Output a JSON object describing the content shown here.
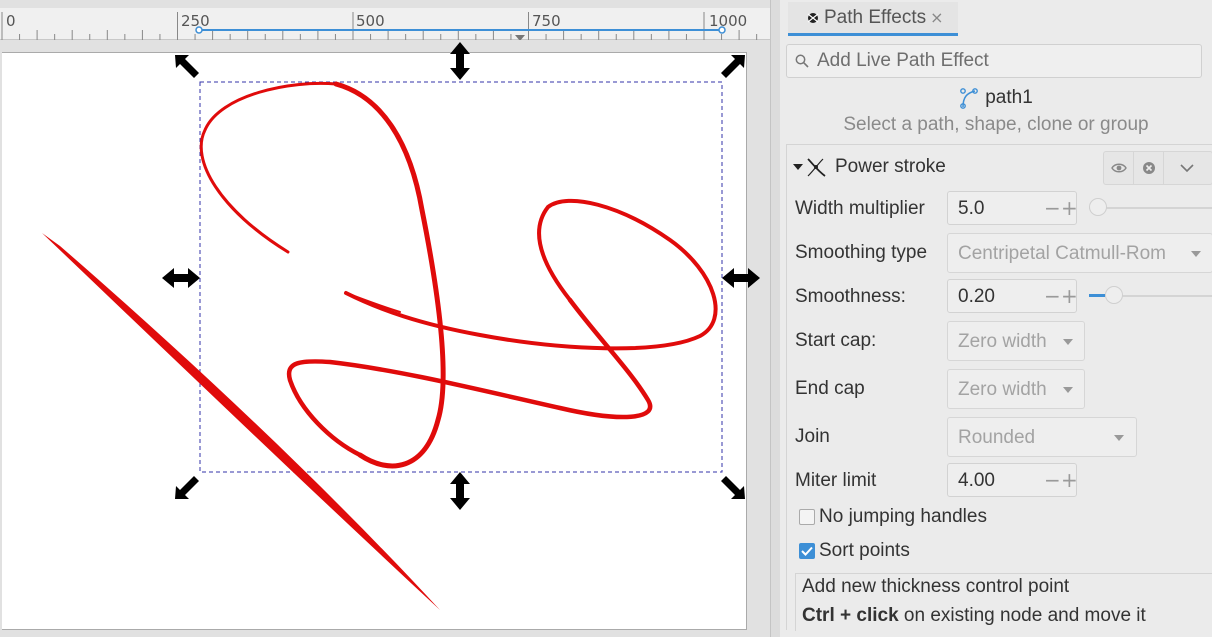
{
  "ruler": {
    "labels": [
      "0",
      "250",
      "500",
      "750",
      "1000"
    ]
  },
  "canvas": {
    "stroke_color": "#e00b0b",
    "selection_color": "#3333aa",
    "handle_color": "#000000"
  },
  "dock": {
    "tab": {
      "label": "Path Effects",
      "close_glyph": "×",
      "icon": "path-effects-icon"
    },
    "search": {
      "placeholder": "Add Live Path Effect",
      "icon": "search-icon"
    },
    "object": {
      "name": "path1",
      "icon": "path-node-icon"
    },
    "hint": "Select a path, shape, clone or group",
    "effect": {
      "title": "Power stroke",
      "icon": "power-stroke-icon",
      "buttons": [
        "eye-icon",
        "remove-icon",
        "chevron-down-icon"
      ],
      "width_multiplier": {
        "label": "Width multiplier",
        "value": "5.0",
        "slider_fraction": 0.0
      },
      "smoothing_type": {
        "label": "Smoothing type",
        "value": "Centripetal Catmull-Rom"
      },
      "smoothness": {
        "label": "Smoothness:",
        "value": "0.20",
        "slider_fraction": 0.2
      },
      "start_cap": {
        "label": "Start cap:",
        "value": "Zero width"
      },
      "end_cap": {
        "label": "End cap",
        "value": "Zero width"
      },
      "join": {
        "label": "Join",
        "value": "Rounded"
      },
      "miter_limit": {
        "label": "Miter limit",
        "value": "4.00"
      },
      "no_jumping_handles": {
        "label": "No jumping handles",
        "checked": false
      },
      "sort_points": {
        "label": "Sort points",
        "checked": true
      },
      "help": {
        "line1": "Add new thickness control point",
        "line2_bold": "Ctrl + click",
        "line2_rest": " on existing node and move it"
      },
      "spin_minus": "−",
      "spin_plus": "+"
    },
    "accent_color": "#3d8fd6"
  }
}
